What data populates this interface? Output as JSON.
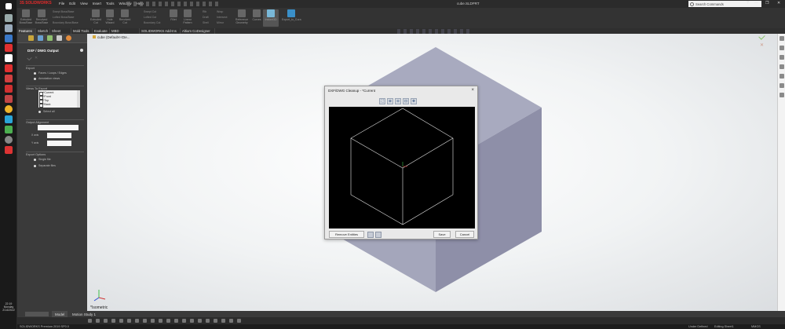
{
  "app": {
    "logo_main": "3S SOLIDWORKS",
    "menus": [
      "File",
      "Edit",
      "View",
      "Insert",
      "Tools",
      "Window",
      "Help"
    ],
    "document_title": "cube.SLDPRT",
    "search_placeholder": "Search Commands",
    "window_controls": [
      "?",
      "—",
      "❐",
      "✕"
    ]
  },
  "ribbon": {
    "commands": [
      {
        "label": "Extruded Boss/Base",
        "icon": "extruded-boss-icon"
      },
      {
        "label": "Revolved Boss/Base",
        "icon": "revolved-boss-icon"
      },
      {
        "label": "Extruded Cut",
        "icon": "extruded-cut-icon"
      },
      {
        "label": "Hole Wizard",
        "icon": "hole-wizard-icon"
      },
      {
        "label": "Revolved Cut",
        "icon": "revolved-cut-icon"
      },
      {
        "label": "Fillet",
        "icon": "fillet-icon"
      },
      {
        "label": "Linear Pattern",
        "icon": "linear-pattern-icon"
      },
      {
        "label": "Reference Geometry",
        "icon": "reference-geometry-icon"
      },
      {
        "label": "Curves",
        "icon": "curves-icon"
      },
      {
        "label": "Instant3D",
        "icon": "instant3d-icon"
      },
      {
        "label": "Export_to_Cura",
        "icon": "export-cura-icon"
      }
    ],
    "small_commands": [
      "Swept Boss/Base",
      "Lofted Boss/Base",
      "Boundary Boss/Base",
      "Swept Cut",
      "Lofted Cut",
      "Boundary Cut",
      "Rib",
      "Draft",
      "Shell",
      "Wrap",
      "Intersect",
      "Mirror"
    ]
  },
  "tabs": [
    "Features",
    "Sketch",
    "Sheet Metal",
    "Mold Tools",
    "Evaluate",
    "MBD Dimensions",
    "SOLIDWORKS Add-Ins",
    "Altium CoDesigner"
  ],
  "breadcrumb": "cube (Default<<De...",
  "feature_manager": {
    "title": "DXF / DWG Output",
    "export_section": "Export",
    "export_options": [
      "Faces / Loops / Edges",
      "Annotation views"
    ],
    "views_section": "Views To Export",
    "views": [
      "*Current",
      "*Front",
      "*Top",
      "*Back"
    ],
    "select_all": "Select all",
    "alignment_section": "Output Alignment",
    "x_label": "X axis",
    "y_label": "Y axis",
    "options_section": "Export Options",
    "options": [
      "Single file",
      "Separate files"
    ]
  },
  "graphics": {
    "view_label": "*Isometric"
  },
  "dialog": {
    "title": "DXF/DWG Cleanup - *Current",
    "close": "×",
    "tool_glyphs": [
      "⛶",
      "⊕",
      "⊖",
      "⊡",
      "✥"
    ],
    "remove_label": "Remove Entities",
    "save_label": "Save",
    "cancel_label": "Cancel"
  },
  "bottom_tabs": [
    "Model",
    "Motion Study 1"
  ],
  "status": {
    "left": "SOLIDWORKS Premium 2019 SP0.0",
    "state": "Under Defined",
    "sheet": "Editing Sheet1",
    "units": "MMGS"
  },
  "clock": {
    "time": "22:19",
    "day": "Monday",
    "date": "2/14/2022"
  },
  "colors": {
    "accent_red": "#e02b2b",
    "cube_top": "#a8aabf",
    "cube_right": "#8e8fa8",
    "cube_left": "#a4a6bb",
    "cleanup_lines": "#e8e8e8",
    "axis_green": "#3fbf4a"
  }
}
